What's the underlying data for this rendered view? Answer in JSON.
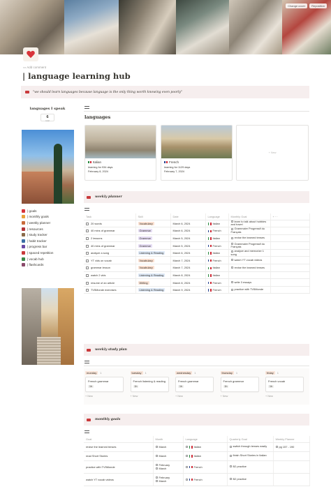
{
  "cover": {
    "buttons": [
      "Change cover",
      "Reposition"
    ]
  },
  "page": {
    "add_comment": "Add comment",
    "title": "| language learning hub",
    "quote": "\"we should learn languages because language is the only thing worth knowing even poorly\""
  },
  "sidebar": {
    "speak_title": "languages I speak",
    "count_value": "6",
    "count_label": "total",
    "items": [
      {
        "label": "| goals",
        "icon": "heart-icon",
        "color": "#d8343a"
      },
      {
        "label": "| monthly goals",
        "icon": "calendar-icon",
        "color": "#e9a23b"
      },
      {
        "label": "| weekly planner",
        "icon": "planner-icon",
        "color": "#c96b3a"
      },
      {
        "label": "| resources",
        "icon": "book-icon",
        "color": "#b3353a"
      },
      {
        "label": "| study tracker",
        "icon": "books-icon",
        "color": "#8a6b4a"
      },
      {
        "label": "| habit tracker",
        "icon": "chart-icon",
        "color": "#3b6ea5"
      },
      {
        "label": "| progress bar",
        "icon": "bar-icon",
        "color": "#6b4aa5"
      },
      {
        "label": "| spaced repetition",
        "icon": "cards-icon",
        "color": "#c9393b"
      },
      {
        "label": "| vocab hub",
        "icon": "notebook-icon",
        "color": "#3b8a4a"
      },
      {
        "label": "| flashcards",
        "icon": "flashcard-icon",
        "color": "#8a4a6b"
      }
    ]
  },
  "languages": {
    "heading": "languages",
    "new_label": "+ New",
    "cards": [
      {
        "name": "Italian",
        "flag": [
          "#2a8a3e",
          "#ffffff",
          "#cf2b37"
        ],
        "studied": "learning for 934 days",
        "date": "February 8, 2024"
      },
      {
        "name": "French",
        "flag": [
          "#24418f",
          "#ffffff",
          "#cf2b37"
        ],
        "studied": "learning for 1129 days",
        "date": "February 7, 2024"
      }
    ]
  },
  "weekly_planner": {
    "heading": "weekly planner",
    "columns": [
      "Task",
      "Skill",
      "Date",
      "Language",
      "Monthly Goal"
    ],
    "rows": [
      {
        "task": "20 words",
        "skill": "Vocabulary",
        "skill_class": "voc",
        "date": "March 6, 2024",
        "lang": "Italian",
        "flag": [
          "#2a8a3e",
          "#ffffff",
          "#cf2b37"
        ],
        "goal": "learn to talk about hobbies and travel"
      },
      {
        "task": "40 mins of grammar",
        "skill": "Grammar",
        "skill_class": "gra",
        "date": "March 6, 2024",
        "lang": "French",
        "flag": [
          "#24418f",
          "#ffffff",
          "#cf2b37"
        ],
        "goal": "Grammaire Progressif du Français"
      },
      {
        "task": "2 lessons",
        "skill": "Grammar",
        "skill_class": "gra",
        "date": "March 5, 2024",
        "lang": "Italian",
        "flag": [
          "#2a8a3e",
          "#ffffff",
          "#cf2b37"
        ],
        "goal": "revise the learned tenses"
      },
      {
        "task": "40 mins of grammar",
        "skill": "Grammar",
        "skill_class": "gra",
        "date": "March 5, 2024",
        "lang": "French",
        "flag": [
          "#24418f",
          "#ffffff",
          "#cf2b37"
        ],
        "goal": "Grammaire Progressif du Français"
      },
      {
        "task": "analyze a song",
        "skill": "Listening & Reading",
        "skill_class": "lr",
        "date": "March 6, 2024",
        "lang": "Italian",
        "flag": [
          "#2a8a3e",
          "#ffffff",
          "#cf2b37"
        ],
        "goal": "analyze and memorize 1 song"
      },
      {
        "task": "YT vids on vocab",
        "skill": "Vocabulary",
        "skill_class": "voc",
        "date": "March 7, 2024",
        "lang": "French",
        "flag": [
          "#24418f",
          "#ffffff",
          "#cf2b37"
        ],
        "goal": "watch YT vocab videos"
      },
      {
        "task": "grammar lesson",
        "skill": "Vocabulary",
        "skill_class": "voc",
        "date": "March 7, 2024",
        "lang": "Italian",
        "flag": [
          "#2a8a3e",
          "#ffffff",
          "#cf2b37"
        ],
        "goal": "revise the learned tenses"
      },
      {
        "task": "watch 2 vids",
        "skill": "Listening & Reading",
        "skill_class": "lr",
        "date": "March 8, 2024",
        "lang": "Italian",
        "flag": [
          "#2a8a3e",
          "#ffffff",
          "#cf2b37"
        ],
        "goal": ""
      },
      {
        "task": "resume of an article",
        "skill": "Writing",
        "skill_class": "wri",
        "date": "March 8, 2024",
        "lang": "French",
        "flag": [
          "#24418f",
          "#ffffff",
          "#cf2b37"
        ],
        "goal": "write 3 essays"
      },
      {
        "task": "TV5Monde exercises",
        "skill": "Listening & Reading",
        "skill_class": "lr",
        "date": "March 9, 2024",
        "lang": "French",
        "flag": [
          "#24418f",
          "#ffffff",
          "#cf2b37"
        ],
        "goal": "practice with TV5Monde"
      }
    ]
  },
  "study_plan": {
    "heading": "weekly study plan",
    "new_label": "+ New",
    "days": [
      {
        "day": "monday",
        "count": "1",
        "task": "French grammar",
        "pill": "1h"
      },
      {
        "day": "tuesday",
        "count": "1",
        "task": "French listening & reading",
        "pill": "1h"
      },
      {
        "day": "wednesday",
        "count": "1",
        "task": "French grammar",
        "pill": "1h"
      },
      {
        "day": "thursday",
        "count": "1",
        "task": "French grammar",
        "pill": "1h"
      },
      {
        "day": "friday",
        "count": "1",
        "task": "French vocab",
        "pill": "1h"
      }
    ]
  },
  "monthly_goals": {
    "heading": "monthly goals",
    "columns": [
      "Goal",
      "Month",
      "Language",
      "Quarterly Goal",
      "Weekly Planner"
    ],
    "rows": [
      {
        "goal": "revise the learned tenses",
        "month": "March",
        "lang": "Italian",
        "flag": [
          "#2a8a3e",
          "#ffffff",
          "#cf2b37"
        ],
        "quarterly": "switch through tenses easily",
        "planner": "pg 157 - 190"
      },
      {
        "goal": "read Short Stories",
        "month": "March",
        "lang": "Italian",
        "flag": [
          "#2a8a3e",
          "#ffffff",
          "#cf2b37"
        ],
        "quarterly": "finish Short Stories in Italian",
        "planner": ""
      },
      {
        "goal": "practice with TV5Monde",
        "month": "February",
        "month2": "March",
        "lang": "French",
        "flag": [
          "#24418f",
          "#ffffff",
          "#cf2b37"
        ],
        "quarterly": "B2 practice",
        "planner": ""
      },
      {
        "goal": "watch YT vocab videos",
        "month": "February",
        "month2": "March",
        "lang": "French",
        "flag": [
          "#24418f",
          "#ffffff",
          "#cf2b37"
        ],
        "quarterly": "B2 practice",
        "planner": ""
      }
    ]
  }
}
